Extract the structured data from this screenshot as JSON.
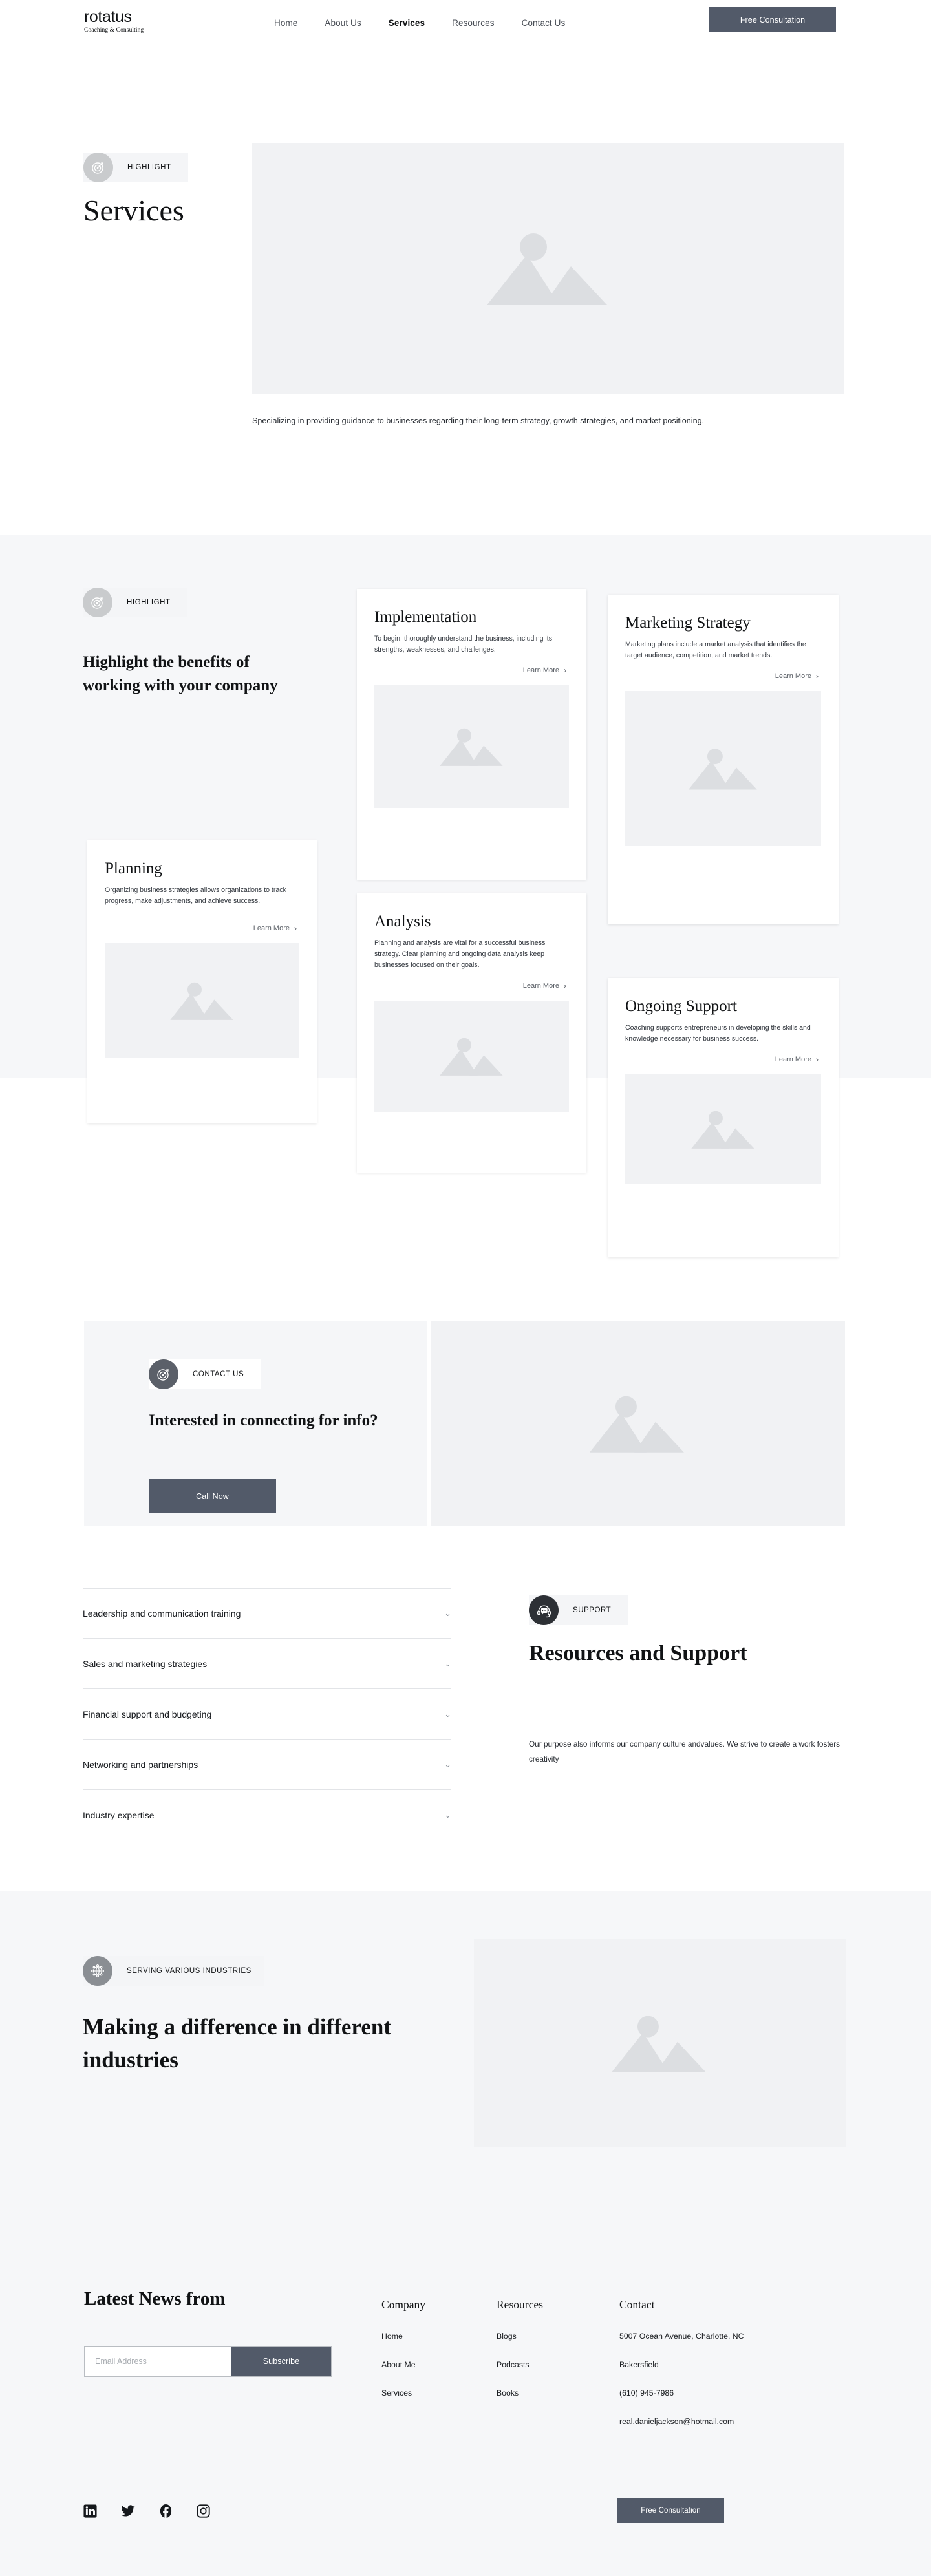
{
  "header": {
    "logo_main": "rotatus",
    "logo_sub": "Coaching & Consulting",
    "nav": [
      {
        "label": "Home",
        "active": false
      },
      {
        "label": "About Us",
        "active": false
      },
      {
        "label": "Services",
        "active": true
      },
      {
        "label": "Resources",
        "active": false
      },
      {
        "label": "Contact Us",
        "active": false
      }
    ],
    "cta_label": "Free Consultation"
  },
  "hero": {
    "badge_label": "HIGHLIGHT",
    "badge_icon": "target-icon",
    "title": "Services",
    "description": "Specializing in providing guidance to businesses regarding their long-term strategy, growth strategies, and market positioning.",
    "image": "mountain-placeholder-image"
  },
  "highlight": {
    "badge_label": "HIGHLIGHT",
    "badge_icon": "target-icon",
    "title": "Highlight the benefits of working with your company",
    "learn_more_label": "Learn More",
    "cards": [
      {
        "title": "Implementation",
        "body": "To begin, thoroughly understand the business, including its strengths, weaknesses, and challenges.",
        "link": "Learn More"
      },
      {
        "title": "Marketing Strategy",
        "body": "Marketing plans include a market analysis that identifies the target audience, competition, and market trends.",
        "link": "Learn More"
      },
      {
        "title": "Planning",
        "body": "Organizing business strategies allows organizations to track progress, make adjustments, and achieve success.",
        "link": "Learn More"
      },
      {
        "title": "Analysis",
        "body": "Planning and analysis are vital for a successful business strategy. Clear planning and ongoing data analysis keep businesses focused on their goals.",
        "link": "Learn More"
      },
      {
        "title": "Ongoing Support",
        "body": "Coaching supports entrepreneurs in developing the skills and knowledge necessary for business success.",
        "link": "Learn More"
      }
    ]
  },
  "contact": {
    "badge_label": "CONTACT US",
    "badge_icon": "target-icon",
    "title": "Interested in connecting for info?",
    "button_label": "Call Now",
    "image": "mountain-placeholder-image"
  },
  "accordion": {
    "items": [
      {
        "label": "Leadership and communication training"
      },
      {
        "label": "Sales and marketing strategies"
      },
      {
        "label": "Financial support and budgeting"
      },
      {
        "label": "Networking and partnerships"
      },
      {
        "label": "Industry expertise"
      }
    ]
  },
  "resources": {
    "badge_label": "SUPPORT",
    "badge_icon": "headset-support-icon",
    "title": "Resources and Support",
    "description": "Our purpose also informs our company culture andvalues. We strive to create a work fosters creativity"
  },
  "industries": {
    "badge_label": "SERVING VARIOUS INDUSTRIES",
    "badge_icon": "globe-network-icon",
    "title": "Making a difference in different industries",
    "image": "mountain-placeholder-image"
  },
  "footer": {
    "newsletter_title": "Latest News from",
    "email_placeholder": "Email Address",
    "email_value": "",
    "subscribe_label": "Subscribe",
    "columns": [
      {
        "heading": "Company",
        "links": [
          "Home",
          "About Me",
          "Services"
        ]
      },
      {
        "heading": "Resources",
        "links": [
          "Blogs",
          "Podcasts",
          "Books"
        ]
      }
    ],
    "contact_heading": "Contact",
    "contact_lines": [
      "5007 Ocean Avenue, Charlotte, NC",
      "Bakersfield",
      "(610) 945-7986",
      "real.danieljackson@hotmail.com"
    ],
    "socials": [
      "linkedin-icon",
      "twitter-icon",
      "facebook-icon",
      "instagram-icon"
    ],
    "cta_label": "Free Consultation"
  },
  "colors": {
    "accent": "#525a69",
    "section_bg": "#f6f7f9",
    "placeholder_bg": "#f1f2f4",
    "text": "#111315"
  }
}
